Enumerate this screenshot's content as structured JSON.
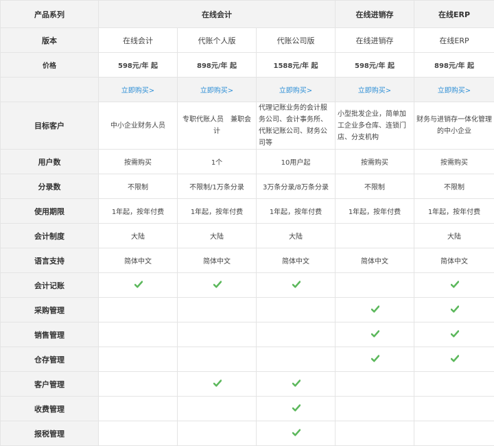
{
  "header": {
    "series_label": "产品系列",
    "group_online_accounting": "在线会计",
    "group_online_inventory": "在线进销存",
    "group_online_erp": "在线ERP"
  },
  "rows": {
    "version": {
      "label": "版本",
      "values": [
        "在线会计",
        "代账个人版",
        "代账公司版",
        "在线进销存",
        "在线ERP"
      ]
    },
    "price": {
      "label": "价格",
      "values": [
        "598元/年 起",
        "898元/年 起",
        "1588元/年 起",
        "598元/年 起",
        "898元/年 起"
      ]
    },
    "buy": {
      "values": [
        "立即购买>",
        "立即购买>",
        "立即购买>",
        "立即购买>",
        "立即购买>"
      ]
    },
    "target_customer": {
      "label": "目标客户",
      "values": [
        "中小企业财务人员",
        "专职代账人员　兼职会计",
        "代理记账业务的会计服务公司、会计事务所、代账记账公司、财务公司等",
        "小型批发企业，简单加工企业多仓库、连锁门店、分支机构",
        "财务与进销存一体化管理的中小企业"
      ]
    },
    "users": {
      "label": "用户数",
      "values": [
        "按需购买",
        "1个",
        "10用户起",
        "按需购买",
        "按需购买"
      ]
    },
    "entries": {
      "label": "分录数",
      "values": [
        "不限制",
        "不限制/1万条分录",
        "3万条分录/8万条分录",
        "不限制",
        "不限制"
      ]
    },
    "term": {
      "label": "使用期限",
      "values": [
        "1年起，按年付费",
        "1年起，按年付费",
        "1年起，按年付费",
        "1年起，按年付费",
        "1年起，按年付费"
      ]
    },
    "system": {
      "label": "会计制度",
      "values": [
        "大陆",
        "大陆",
        "大陆",
        "",
        "大陆"
      ]
    },
    "language": {
      "label": "语言支持",
      "values": [
        "简体中文",
        "简体中文",
        "简体中文",
        "简体中文",
        "简体中文"
      ]
    }
  },
  "features": [
    {
      "label": "会计记账",
      "checks": [
        true,
        true,
        true,
        false,
        true
      ]
    },
    {
      "label": "采购管理",
      "checks": [
        false,
        false,
        false,
        true,
        true
      ]
    },
    {
      "label": "销售管理",
      "checks": [
        false,
        false,
        false,
        true,
        true
      ]
    },
    {
      "label": "仓存管理",
      "checks": [
        false,
        false,
        false,
        true,
        true
      ]
    },
    {
      "label": "客户管理",
      "checks": [
        false,
        true,
        true,
        false,
        false
      ]
    },
    {
      "label": "收费管理",
      "checks": [
        false,
        false,
        true,
        false,
        false
      ]
    },
    {
      "label": "报税管理",
      "checks": [
        false,
        false,
        true,
        false,
        false
      ]
    }
  ],
  "colors": {
    "check": "#5cb85c",
    "link": "#2e8fd6",
    "header_bg": "#f3f3f3",
    "border": "#e4e4e4"
  }
}
